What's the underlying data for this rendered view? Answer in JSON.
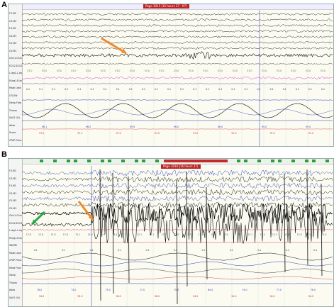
{
  "panels": {
    "a": {
      "letter": "A",
      "title_tag": "Page 3015 (16 hours 37 - 07)",
      "channel_labels": [
        "F3-M2",
        "C3-M2",
        "F4-M1",
        "C4-M1",
        "O1-M2",
        "O2-M1",
        "Chin1-Chin2",
        "ECG2-ECG1",
        "L-leg1-L-leg2",
        "R-leg1-R-leg2",
        "Mask Leak",
        "CFLOW",
        "Sleep Flow",
        "Thorax",
        "SpO2 (%)",
        "Abdo",
        "Snore",
        "CPAP Press"
      ],
      "spo2_values": [
        "96.1",
        "96.0",
        "95.9",
        "96.0",
        "96.0",
        "95.0",
        "95.0"
      ],
      "cflow_values": [
        "97.0",
        "97.1",
        "97.0",
        "97.0",
        "97.0",
        "97.0",
        "97.0",
        "97.0"
      ],
      "mask_values": [
        "0.1",
        "0.1",
        "0.1",
        "0.1",
        "0.1",
        "0.1",
        "0.1",
        "0.1",
        "0.1",
        "0.1",
        "0.1",
        "0.1",
        "0.1",
        "0.1",
        "0.1",
        "0.1",
        "0.1",
        "0.1",
        "0.1",
        "0.1",
        "0.1",
        "0.1",
        "0.1",
        "0.1"
      ],
      "ecg_values": [
        "53.0",
        "53.0",
        "53.0",
        "53.0",
        "53.0",
        "53.0",
        "53.0",
        "53.0",
        "53.0",
        "53.0",
        "53.0",
        "53.0",
        "53.0",
        "53.0",
        "53.0",
        "53.0",
        "53.0",
        "53.0",
        "53.0",
        "53.0",
        "53.0"
      ]
    },
    "b": {
      "letter": "B",
      "title_tag": "Page 3016 (16 hours 37)",
      "channel_labels": [
        "F3-M2",
        "C3-M2",
        "F4-M1",
        "C4-M1",
        "O1-M2",
        "O2-M1",
        "Chin1-Chin2",
        "ECG2-ECG1",
        "L-leg1-L-leg2",
        "R-leg1-R-leg2",
        "SNORE",
        "Mask Leak",
        "CPAP Press",
        "Head Flow",
        "Sleep",
        "Thorax",
        "Abdo",
        "SpO2 (%)"
      ],
      "ecg_values": [
        "13.8",
        "12.8",
        "12.8",
        "12.8",
        "13.1",
        "12.9",
        "13.4",
        "13.4",
        "13.5",
        "12.1",
        "13.1",
        "13.2",
        "13.4",
        "13.3",
        "12.8",
        "12.8",
        "13.8",
        "12.8",
        "13.1",
        "12.4",
        "12.3",
        "12.8",
        "12.8",
        "12.8",
        "12.9"
      ],
      "mask_values": [
        "0.1",
        "0.1",
        "0.1",
        "0.1",
        "0.1",
        "0.1",
        "0.1",
        "0.1",
        "0.1",
        "0.1",
        "0.1"
      ],
      "flow_values": [
        "76.0",
        "74.0",
        "75.0",
        "77.0",
        "75.0",
        "80.0",
        "79.0",
        "77.0",
        "78.0"
      ],
      "spo2_values": [
        "94.0",
        "95.0",
        "96.0",
        "96.0",
        "94.0",
        "94.0",
        "94.0",
        "94.0"
      ]
    }
  },
  "colors": {
    "arrow_orange": "#f08a2c",
    "arrow_green": "#29a84a",
    "trace_black": "#111111",
    "trace_blue": "#2a3fb0",
    "trace_magenta": "#d12bd1",
    "trace_red": "#c62828"
  }
}
